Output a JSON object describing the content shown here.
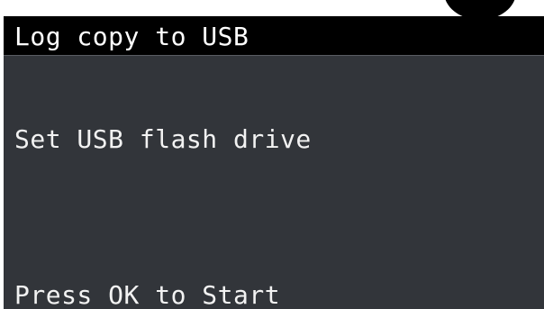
{
  "screen": {
    "title": "Log copy to USB",
    "message": "Set USB flash drive",
    "prompt": "Press OK to Start"
  },
  "colors": {
    "background": "#32353a",
    "title_bar": "#000000",
    "text": "#f2f2f2"
  }
}
